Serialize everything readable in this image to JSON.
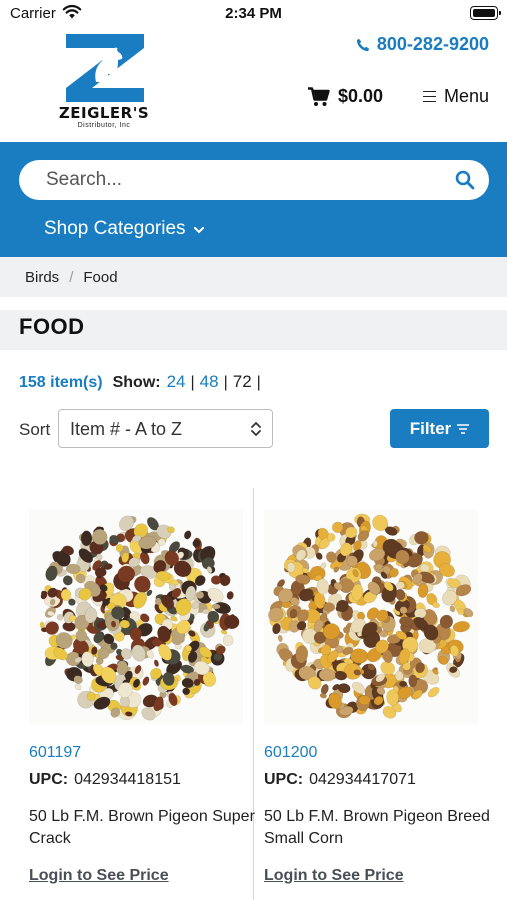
{
  "status_bar": {
    "carrier": "Carrier",
    "time": "2:34 PM"
  },
  "header": {
    "brand": {
      "name": "ZEIGLER'S",
      "subtitle": "Distributor, Inc"
    },
    "phone": "800-282-9200",
    "cart_total": "$0.00",
    "menu_label": "Menu"
  },
  "search": {
    "placeholder": "Search..."
  },
  "nav": {
    "shop_categories": "Shop Categories"
  },
  "breadcrumb": [
    "Birds",
    "Food"
  ],
  "page_title": "FOOD",
  "results": {
    "item_count": "158 item(s)",
    "show_label": "Show:",
    "show_options": [
      "24",
      "48",
      "72"
    ]
  },
  "sort": {
    "label": "Sort",
    "value": "Item # - A to Z"
  },
  "filter": {
    "label": "Filter"
  },
  "products": [
    {
      "sku": "601197",
      "upc_label": "UPC:",
      "upc": "042934418151",
      "name": "50 Lb F.M. Brown Pigeon Super Crack",
      "price_link": "Login to See Price"
    },
    {
      "sku": "601200",
      "upc_label": "UPC:",
      "upc": "042934417071",
      "name": "50 Lb F.M. Brown Pigeon Breed Small Corn",
      "price_link": "Login to See Price"
    }
  ],
  "colors": {
    "brand_blue": "#1a7dc1",
    "band_gray": "#f0f1f3"
  }
}
